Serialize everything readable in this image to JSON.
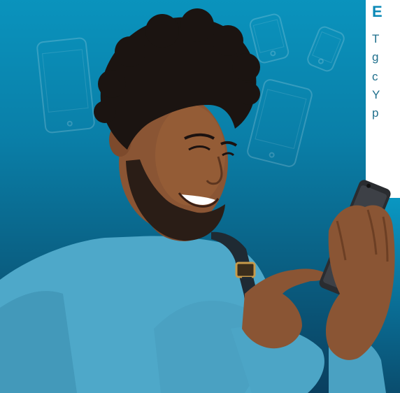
{
  "hero": {
    "background_top": "#0a93bd",
    "background_bottom": "#0a3f5f",
    "subject": "man-smiling-using-smartphone"
  },
  "snippet": {
    "heading": "E",
    "lines": [
      "T",
      "g",
      "c",
      "Y",
      "p"
    ],
    "heading_color": "#0a88b6",
    "text_color": "#1f6f8c"
  },
  "decor": {
    "icon": "smartphone-outline-icon"
  }
}
